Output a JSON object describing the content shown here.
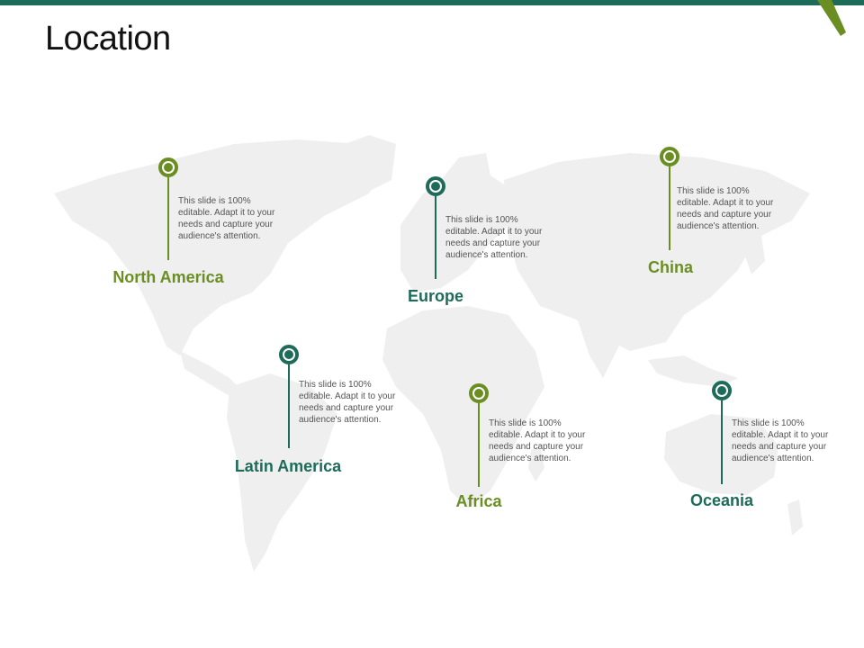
{
  "title": "Location",
  "colors": {
    "olive": "#6b8e23",
    "teal": "#1e6b5a",
    "map": "#efefef",
    "desc_text": "#555555"
  },
  "markers": [
    {
      "name": "North America",
      "description": "This slide is 100% editable.  Adapt it to your needs and capture your audience's attention.",
      "color": "olive"
    },
    {
      "name": "Europe",
      "description": "This slide is 100% editable.  Adapt it to your needs and capture your audience's attention.",
      "color": "teal"
    },
    {
      "name": "China",
      "description": "This slide is 100% editable.  Adapt it to your needs and capture your audience's attention.",
      "color": "olive"
    },
    {
      "name": "Latin America",
      "description": "This slide is 100% editable.  Adapt it to your needs and capture your audience's attention.",
      "color": "teal"
    },
    {
      "name": "Africa",
      "description": "This slide is 100% editable.  Adapt it to your needs and capture your audience's attention.",
      "color": "olive"
    },
    {
      "name": "Oceania",
      "description": "This slide is 100% editable.  Adapt it to your needs and capture your audience's attention.",
      "color": "teal"
    }
  ]
}
